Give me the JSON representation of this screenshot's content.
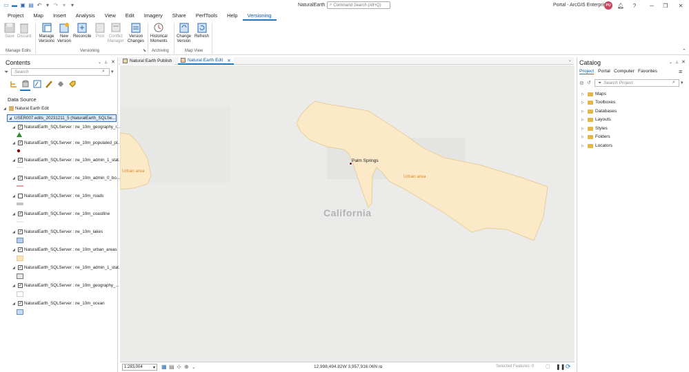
{
  "app": {
    "title": "NaturalEarth",
    "command_search": "Command Search (Alt+Q)",
    "portal": "Portal - ArcGIS Enterprise",
    "user_initials": "PU"
  },
  "ribbon_tabs": [
    "Project",
    "Map",
    "Insert",
    "Analysis",
    "View",
    "Edit",
    "Imagery",
    "Share",
    "PerfTools",
    "Help",
    "Versioning"
  ],
  "ribbon": {
    "save": "Save",
    "discard": "Discard",
    "manage_versions": [
      "Manage",
      "Versions"
    ],
    "new_version": [
      "New",
      "Version"
    ],
    "reconcile": "Reconcile",
    "post": "Post",
    "conflict_manager": [
      "Conflict",
      "Manager"
    ],
    "version_changes": [
      "Version",
      "Changes"
    ],
    "historical_moments": [
      "Historical",
      "Moments"
    ],
    "change_version": [
      "Change",
      "Version"
    ],
    "refresh": "Refresh",
    "groups": {
      "manage_edits": "Manage Edits",
      "versioning": "Versioning",
      "archiving": "Archiving",
      "map_view": "Map View"
    }
  },
  "contents": {
    "title": "Contents",
    "search_placeholder": "Search",
    "section": "Data Source",
    "map_name": "Natural Earth Edit",
    "connection": "USER007.edits_20231211_5 (NaturalEarth_SQLSe...",
    "layers": [
      {
        "label": "NaturalEarth_SQLServer : ne_10m_geography_r...",
        "checked": true
      },
      {
        "label": "NaturalEarth_SQLServer : ne_10m_populated_pl...",
        "checked": true
      },
      {
        "label": "NaturalEarth_SQLServer : ne_10m_admin_1_stat...",
        "checked": true
      },
      {
        "label": "NaturalEarth_SQLServer : ne_10m_admin_0_bo...",
        "checked": true
      },
      {
        "label": "NaturalEarth_SQLServer : ne_10m_roads",
        "checked": false
      },
      {
        "label": "NaturalEarth_SQLServer : ne_10m_coastline",
        "checked": true
      },
      {
        "label": "NaturalEarth_SQLServer : ne_10m_lakes",
        "checked": true
      },
      {
        "label": "NaturalEarth_SQLServer : ne_10m_urban_areas",
        "checked": true
      },
      {
        "label": "NaturalEarth_SQLServer : ne_10m_admin_1_stat...",
        "checked": true
      },
      {
        "label": "NaturalEarth_SQLServer : ne_10m_geography_...",
        "checked": true
      },
      {
        "label": "NaturalEarth_SQLServer : ne_10m_ocean",
        "checked": true
      }
    ]
  },
  "view_tabs": [
    {
      "label": "Natural Earth Publish",
      "active": false
    },
    {
      "label": "Natural Earth Edit",
      "active": true
    }
  ],
  "map": {
    "state_label": "California",
    "city_label": "Palm Springs",
    "urban_label_1": "Urban area",
    "urban_label_2": "Urban area"
  },
  "status": {
    "scale": "1:283,004",
    "coordinates": "12,998,494.82W 3,957,916.06N m",
    "selected": "Selected Features: 0"
  },
  "catalog": {
    "title": "Catalog",
    "tabs": [
      "Project",
      "Portal",
      "Computer",
      "Favorites"
    ],
    "search_placeholder": "Search Project",
    "items": [
      "Maps",
      "Toolboxes",
      "Databases",
      "Layouts",
      "Styles",
      "Folders",
      "Locators"
    ]
  },
  "colors": {
    "accent": "#1978c8",
    "urban_fill": "#fbe9c7",
    "urban_stroke": "#e8cf9a",
    "map_bg": "#ebebea"
  }
}
